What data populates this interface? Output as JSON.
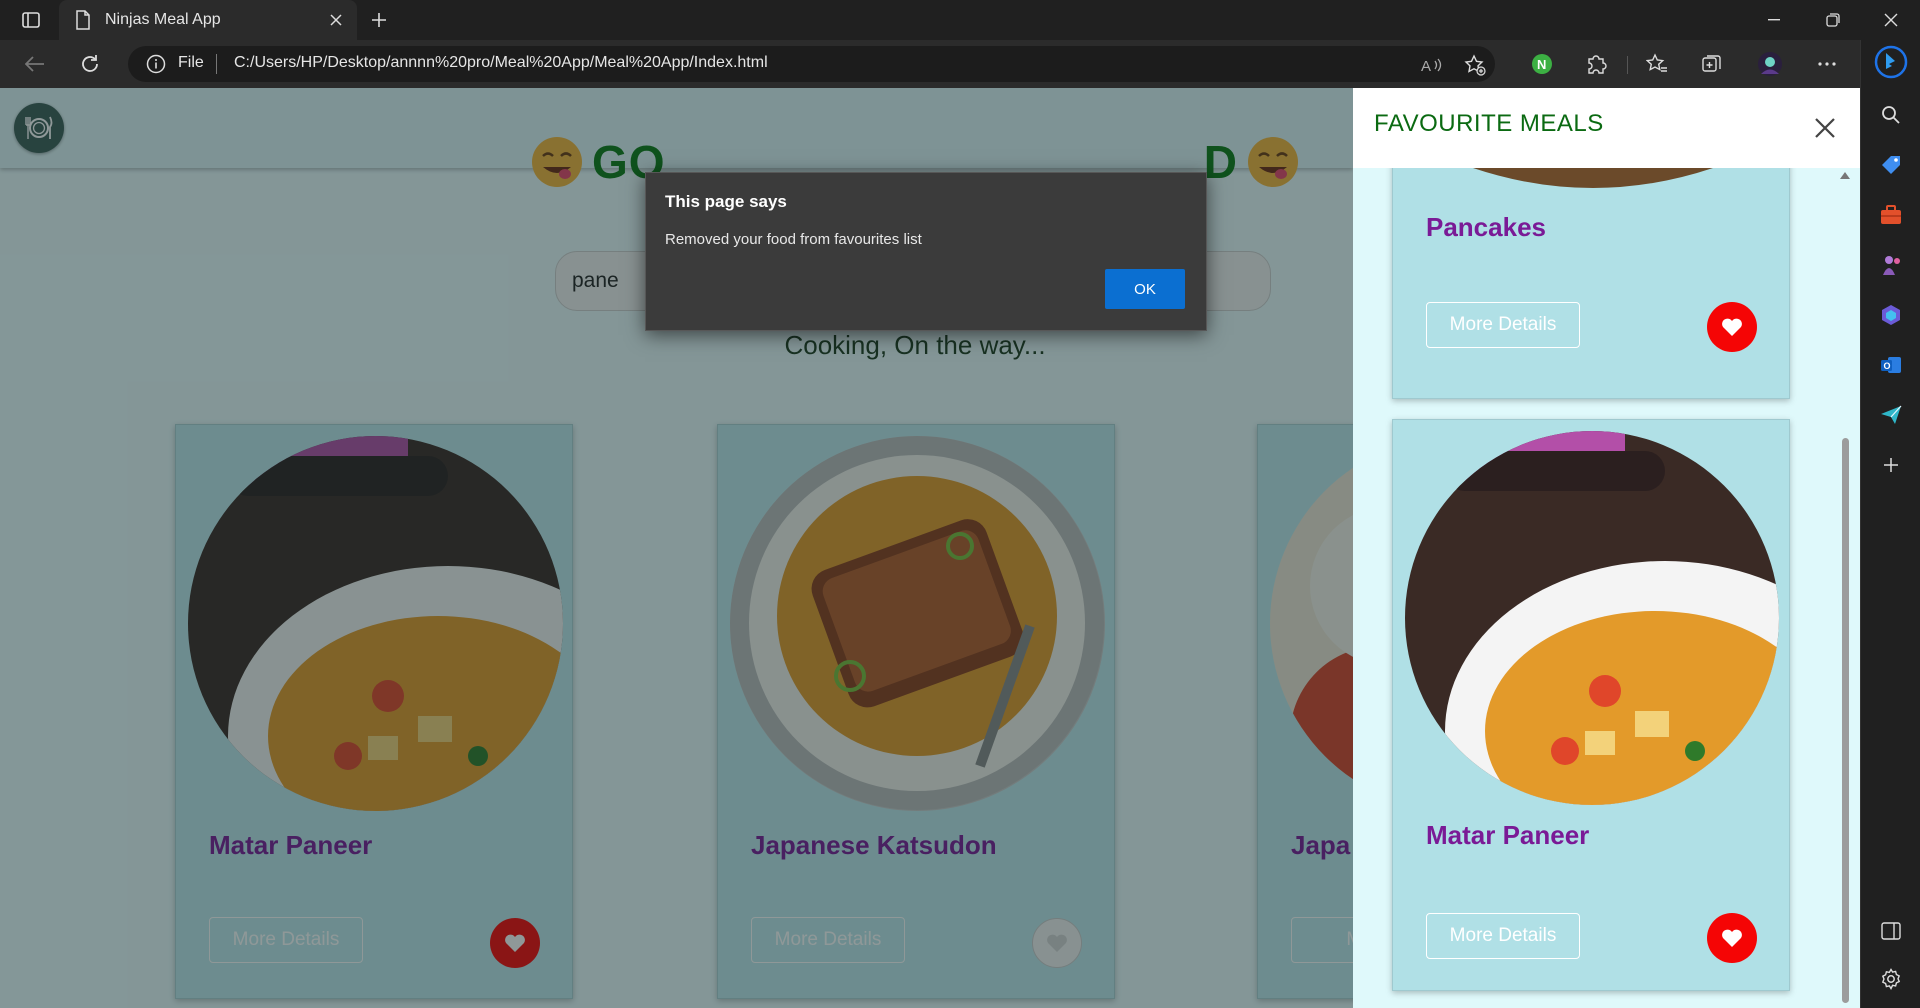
{
  "browser": {
    "tab_title": "Ninjas Meal App",
    "scheme_label": "File",
    "url": "C:/Users/HP/Desktop/annnn%20pro/Meal%20App/Meal%20App/Index.html"
  },
  "page": {
    "heading_left": "GO",
    "heading_right": "D",
    "search_value": "pane",
    "status_text": "Cooking, On the way..."
  },
  "results": [
    {
      "name": "Matar Paneer",
      "more_label": "More Details",
      "favourite": true
    },
    {
      "name": "Japanese Katsudon",
      "more_label": "More Details",
      "favourite": false
    },
    {
      "name": "Japa",
      "more_label": "More",
      "favourite": false
    }
  ],
  "favourites_panel": {
    "title": "FAVOURITE MEALS",
    "items": [
      {
        "name": "Pancakes",
        "more_label": "More Details"
      },
      {
        "name": "Matar Paneer",
        "more_label": "More Details"
      }
    ]
  },
  "alert": {
    "title": "This page says",
    "message": "Removed your food from favourites list",
    "ok_label": "OK"
  },
  "colors": {
    "heading_green": "#0b7a14",
    "meal_name_purple": "#7a1a96",
    "favourite_red": "#f50505",
    "ok_blue": "#0b6fd1"
  }
}
